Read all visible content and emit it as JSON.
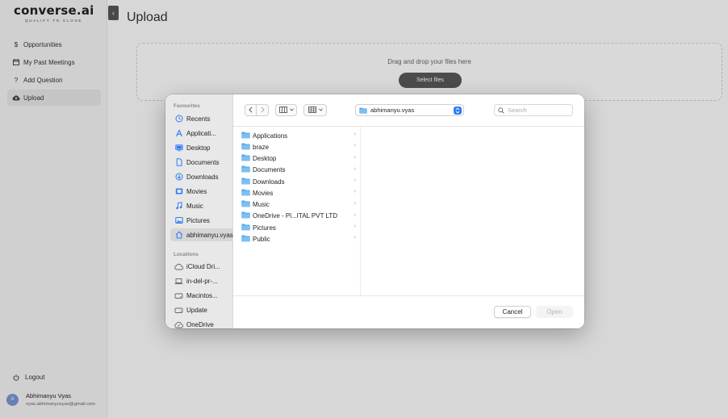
{
  "app": {
    "logo": "converse.ai",
    "tagline": "QUALIFY TO CLOSE",
    "page_title": "Upload",
    "nav": [
      {
        "label": "Opportunities",
        "icon": "dollar-icon"
      },
      {
        "label": "My Past Meetings",
        "icon": "calendar-icon"
      },
      {
        "label": "Add Question",
        "icon": "question-icon"
      },
      {
        "label": "Upload",
        "icon": "cloud-upload-icon",
        "active": true
      }
    ],
    "logout_label": "Logout",
    "user": {
      "initial": "A",
      "name": "Abhimanyu Vyas",
      "email": "vyas.abhimanyuvyas@gmail.com"
    },
    "dropzone": {
      "text": "Drag and drop your files here",
      "button": "Select files"
    }
  },
  "dialog": {
    "favourites_label": "Favourites",
    "favourites": [
      {
        "label": "Recents",
        "icon": "clock-icon"
      },
      {
        "label": "Applicati...",
        "icon": "applications-icon"
      },
      {
        "label": "Desktop",
        "icon": "desktop-icon"
      },
      {
        "label": "Documents",
        "icon": "document-icon"
      },
      {
        "label": "Downloads",
        "icon": "download-icon"
      },
      {
        "label": "Movies",
        "icon": "film-icon"
      },
      {
        "label": "Music",
        "icon": "music-note-icon"
      },
      {
        "label": "Pictures",
        "icon": "photo-icon"
      },
      {
        "label": "abhimanyu.vyas",
        "icon": "home-icon",
        "selected": true
      }
    ],
    "locations_label": "Locations",
    "locations": [
      {
        "label": "iCloud Dri...",
        "icon": "cloud-icon"
      },
      {
        "label": "in-del-pr-...",
        "icon": "laptop-icon"
      },
      {
        "label": "Macintos...",
        "icon": "disk-icon"
      },
      {
        "label": "Update",
        "icon": "disk-icon"
      },
      {
        "label": "OneDrive",
        "icon": "cloud-sync-icon"
      }
    ],
    "location": "abhimanyu.vyas",
    "search_placeholder": "Search",
    "files": [
      "Applications",
      "braze",
      "Desktop",
      "Documents",
      "Downloads",
      "Movies",
      "Music",
      "OneDrive - Pl...ITAL PVT LTD",
      "Pictures",
      "Public"
    ],
    "cancel_label": "Cancel",
    "open_label": "Open",
    "colors": {
      "accent": "#2f7bf5",
      "folder": "#5aa9e6"
    }
  }
}
